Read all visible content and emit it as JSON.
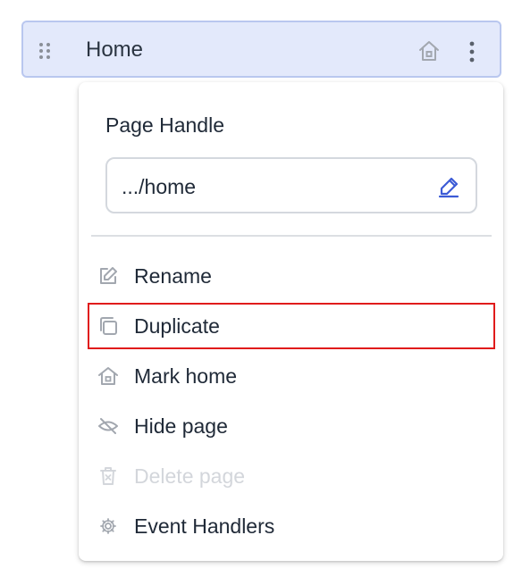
{
  "page_row": {
    "name": "Home",
    "icons": [
      "drag-handle-icon",
      "home-icon",
      "kebab-menu-icon"
    ]
  },
  "menu": {
    "handle_label": "Page Handle",
    "handle_value": ".../home",
    "items": [
      {
        "label": "Rename",
        "icon": "pencil-icon",
        "disabled": false
      },
      {
        "label": "Duplicate",
        "icon": "copy-icon",
        "disabled": false,
        "highlighted": true
      },
      {
        "label": "Mark home",
        "icon": "home-icon",
        "disabled": false
      },
      {
        "label": "Hide page",
        "icon": "eye-off-icon",
        "disabled": false
      },
      {
        "label": "Delete page",
        "icon": "trash-icon",
        "disabled": true
      },
      {
        "label": "Event Handlers",
        "icon": "gear-icon",
        "disabled": false
      }
    ]
  },
  "colors": {
    "row_background": "#e3e9fb",
    "row_border": "#b9c7ef",
    "accent": "#3c5bd6",
    "highlight_border": "#e01b1b",
    "disabled_text": "#d3d6db"
  }
}
